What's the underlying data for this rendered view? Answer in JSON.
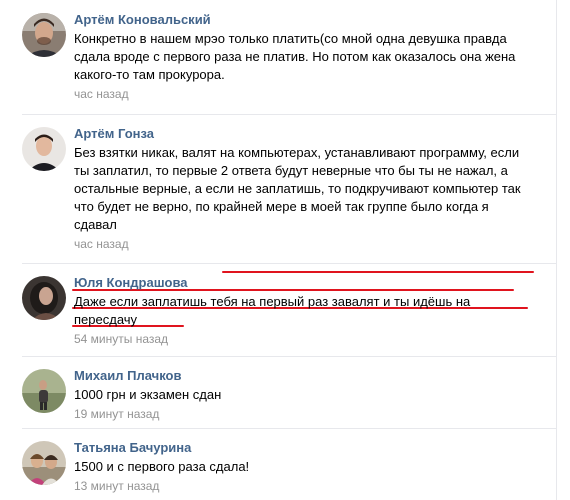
{
  "comments": [
    {
      "author": "Артём Коновальский",
      "lines": [
        "Конкретно в нашем мрэо только платить(со мной одна девушка правда",
        "сдала вроде с первого раза не платив. Но потом как оказалось она жена",
        "какого-то там прокурора."
      ],
      "time": "час назад"
    },
    {
      "author": "Артём Гонза",
      "lines": [
        "Без взятки никак, валят на компьютерах, устанавливают программу, если",
        "ты заплатил, то первые 2 ответа будут неверные что бы ты не нажал, а",
        "остальные верные, а если не заплатишь, то подкручивают компьютер так",
        "что будет не верно, по крайней мере в моей так группе было когда я",
        "сдавал"
      ],
      "time": "час назад"
    },
    {
      "author": "Юля Кондрашова",
      "lines": [
        "Даже если заплатишь тебя на первый раз завалят и ты идёшь на",
        "пересдачу"
      ],
      "time": "54 минуты назад"
    },
    {
      "author": "Михаил Плачков",
      "lines": [
        "1000 грн и экзамен сдан"
      ],
      "time": "19 минут назад"
    },
    {
      "author": "Татьяна Бачурина",
      "lines": [
        "1500 и с первого раза сдала!"
      ],
      "time": "13 минут назад"
    }
  ],
  "colors": {
    "author_link": "#42648b",
    "timestamp": "#939393",
    "separator": "#e7e8ec",
    "annotation_underline": "#e0141e"
  }
}
